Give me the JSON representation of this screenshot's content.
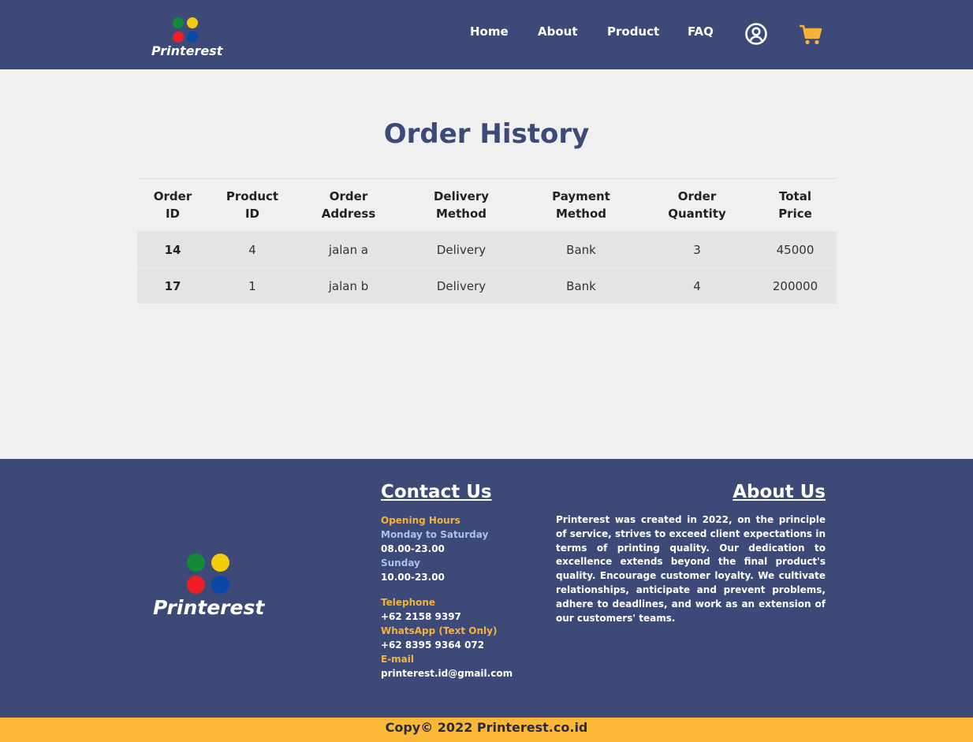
{
  "brand": {
    "name": "Printerest",
    "dot_colors": [
      "#138a3a",
      "#f2cd0b",
      "#ef1d24",
      "#0b47a8"
    ]
  },
  "nav": {
    "items": [
      "Home",
      "About",
      "Product",
      "FAQ"
    ],
    "icons": [
      "user-circle-icon",
      "cart-icon"
    ],
    "cart_color": "#f5b23d"
  },
  "main": {
    "title": "Order History",
    "table": {
      "headers": [
        [
          "Order",
          "ID"
        ],
        [
          "Product",
          "ID"
        ],
        [
          "Order",
          "Address"
        ],
        [
          "Delivery",
          "Method"
        ],
        [
          "Payment",
          "Method"
        ],
        [
          "Order",
          "Quantity"
        ],
        [
          "Total",
          "Price"
        ]
      ],
      "rows": [
        [
          "14",
          "4",
          "jalan a",
          "Delivery",
          "Bank",
          "3",
          "45000"
        ],
        [
          "17",
          "1",
          "jalan b",
          "Delivery",
          "Bank",
          "4",
          "200000"
        ]
      ]
    }
  },
  "footer": {
    "contact": {
      "title": "Contact Us",
      "opening_hours_label": "Opening Hours",
      "weekday_label": "Monday to Saturday",
      "weekday_hours": "08.00-23.00",
      "sunday_label": "Sunday",
      "sunday_hours": "10.00-23.00",
      "telephone_label": "Telephone",
      "telephone": "+62 2158 9397",
      "whatsapp_label": "WhatsApp (Text Only)",
      "whatsapp": "+62 8395 9364 072",
      "email_label": "E-mail",
      "email": "printerest.id@gmail.com"
    },
    "about": {
      "title": "About Us",
      "text": "Printerest was created in 2022, on the principle of service, strives to exceed client expectations in terms of printing quality. Our dedication to excellence extends beyond the final product's quality. Encourage customer loyalty. We cultivate relationships, anticipate and prevent problems, adhere to deadlines, and work as an extension of our customers' teams."
    },
    "copyright": "Copy© 2022 Printerest.co.id"
  },
  "colors": {
    "header_bg": "#3d4977",
    "accent": "#fbb836",
    "page_bg": "#f0f0f0"
  }
}
